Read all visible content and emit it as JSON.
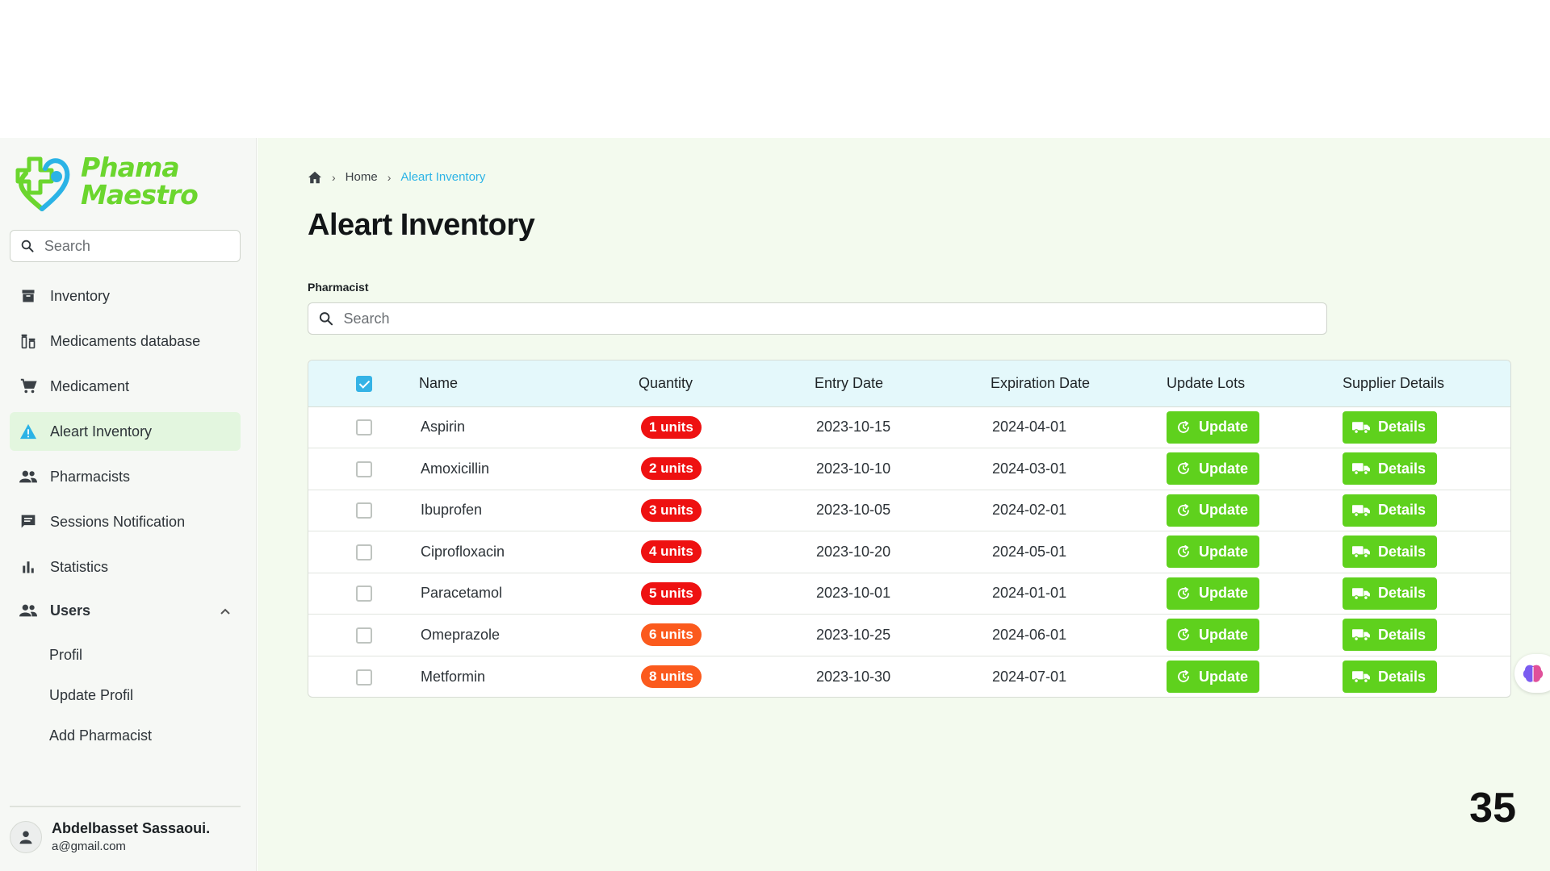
{
  "brand": {
    "line1": "Phama",
    "line2": "Maestro",
    "color": "#6bd62e"
  },
  "sidebar": {
    "search_placeholder": "Search",
    "items": [
      {
        "label": "Inventory",
        "icon": "archive-icon",
        "active": false
      },
      {
        "label": "Medicaments database",
        "icon": "medicine-bottles-icon",
        "active": false
      },
      {
        "label": "Medicament",
        "icon": "cart-icon",
        "active": false
      },
      {
        "label": "Aleart Inventory",
        "icon": "warning-icon",
        "active": true
      },
      {
        "label": "Pharmacists",
        "icon": "people-icon",
        "active": false
      },
      {
        "label": "Sessions Notification",
        "icon": "chat-icon",
        "active": false
      },
      {
        "label": "Statistics",
        "icon": "bar-chart-icon",
        "active": false
      }
    ],
    "users_group": {
      "label": "Users",
      "icon": "people-icon",
      "expanded": true,
      "children": [
        "Profil",
        "Update Profil",
        "Add Pharmacist"
      ]
    },
    "user": {
      "name": "Abdelbasset Sassaoui.",
      "email": "a@gmail.com"
    }
  },
  "breadcrumb": {
    "home_icon": "home-icon",
    "items": [
      "Home",
      "Aleart Inventory"
    ]
  },
  "page": {
    "title": "Aleart Inventory",
    "field_label": "Pharmacist",
    "search_placeholder": "Search"
  },
  "table": {
    "columns": [
      "Name",
      "Quantity",
      "Entry Date",
      "Expiration Date",
      "Update Lots",
      "Supplier Details"
    ],
    "update_label": "Update",
    "details_label": "Details",
    "rows": [
      {
        "name": "Aspirin",
        "quantity": "1 units",
        "entry": "2023-10-15",
        "expiration": "2024-04-01",
        "level": "critical"
      },
      {
        "name": "Amoxicillin",
        "quantity": "2 units",
        "entry": "2023-10-10",
        "expiration": "2024-03-01",
        "level": "critical"
      },
      {
        "name": "Ibuprofen",
        "quantity": "3 units",
        "entry": "2023-10-05",
        "expiration": "2024-02-01",
        "level": "critical"
      },
      {
        "name": "Ciprofloxacin",
        "quantity": "4 units",
        "entry": "2023-10-20",
        "expiration": "2024-05-01",
        "level": "critical"
      },
      {
        "name": "Paracetamol",
        "quantity": "5 units",
        "entry": "2023-10-01",
        "expiration": "2024-01-01",
        "level": "critical"
      },
      {
        "name": "Omeprazole",
        "quantity": "6 units",
        "entry": "2023-10-25",
        "expiration": "2024-06-01",
        "level": "warning"
      },
      {
        "name": "Metformin",
        "quantity": "8 units",
        "entry": "2023-10-30",
        "expiration": "2024-07-01",
        "level": "warning"
      }
    ]
  },
  "colors": {
    "critical": "#ee1111",
    "warning": "#fb5a1d",
    "button": "#5fd11d",
    "accent": "#2bb3e6",
    "active_nav": "#e3f6df"
  },
  "page_number": "35"
}
